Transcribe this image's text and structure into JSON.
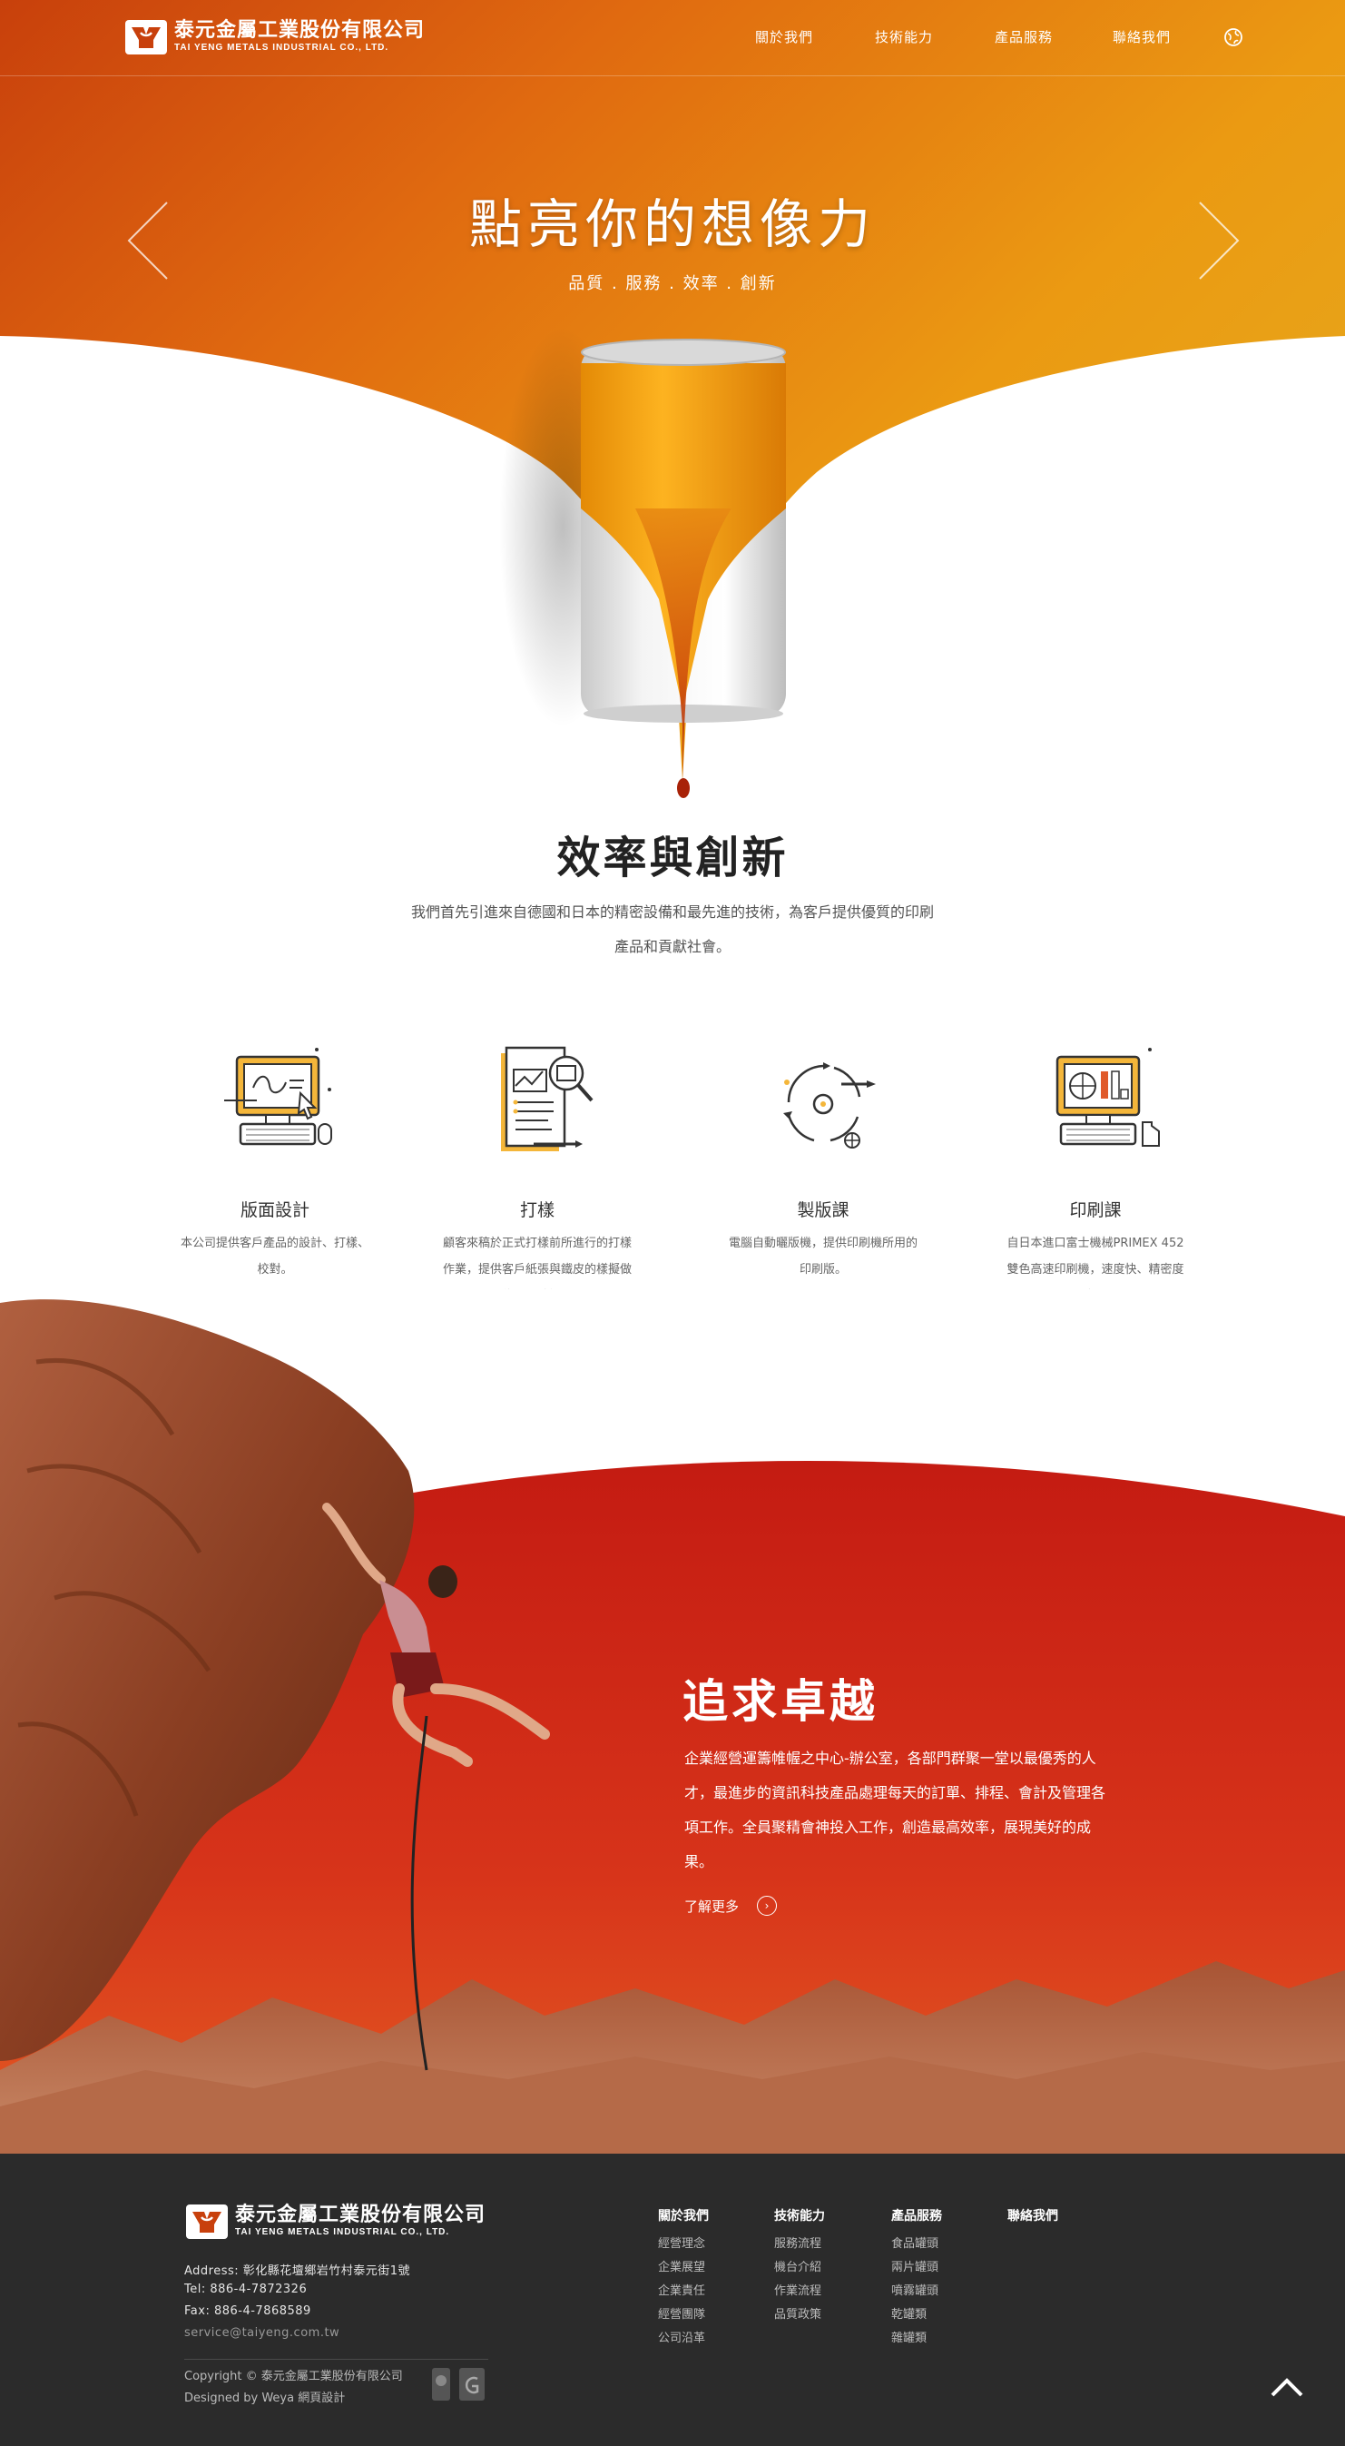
{
  "brand": {
    "name_cn": "泰元金屬工業股份有限公司",
    "name_en": "TAI YENG METALS INDUSTRIAL CO., LTD."
  },
  "nav": {
    "items": [
      {
        "label": "關於我們"
      },
      {
        "label": "技術能力"
      },
      {
        "label": "產品服務"
      },
      {
        "label": "聯絡我們"
      }
    ],
    "globe_icon": "globe-icon"
  },
  "hero": {
    "title": "點亮你的想像力",
    "subtitle": "品質 . 服務 . 效率 . 創新"
  },
  "efficiency": {
    "title": "效率與創新",
    "description": "我們首先引進來自德國和日本的精密設備和最先進的技術，為客戶提供優質的印刷產品和貢獻社會。"
  },
  "services": [
    {
      "title": "版面設計",
      "desc": "本公司提供客戶產品的設計、打樣、校對。",
      "icon": "computer-design-icon"
    },
    {
      "title": "打樣",
      "desc": "顧客來稿於正式打樣前所進行的打樣作業，提供客戶紙張與鐵皮的樣擬做修正及確認。",
      "icon": "proof-document-icon"
    },
    {
      "title": "製版課",
      "desc": "電腦自動曬版機，提供印刷機所用的印刷版。",
      "icon": "plate-cycle-icon"
    },
    {
      "title": "印刷課",
      "desc": "自日本進口富士機械PRIMEX 452 雙色高速印刷機，速度快、精密度高。",
      "icon": "printing-computer-icon"
    }
  ],
  "pursuit": {
    "title": "追求卓越",
    "description": "企業經營運籌帷幄之中心-辦公室，各部門群聚一堂以最優秀的人才，最進步的資訊科技產品處理每天的訂單、排程、會計及管理各項工作。全員聚精會神投入工作，創造最高效率，展現美好的成果。",
    "more_label": "了解更多"
  },
  "footer": {
    "address": "Address: 彰化縣花壇鄉岩竹村泰元街1號",
    "tel": "Tel: 886-4-7872326",
    "fax": "Fax: 886-4-7868589",
    "email": "service@taiyeng.com.tw",
    "copyright": "Copyright © 泰元金屬工業股份有限公司",
    "designed": "Designed by Weya 網頁設計",
    "columns": [
      {
        "title": "關於我們",
        "items": [
          "經營理念",
          "企業展望",
          "企業責任",
          "經營團隊",
          "公司沿革"
        ]
      },
      {
        "title": "技術能力",
        "items": [
          "服務流程",
          "機台介紹",
          "作業流程",
          "品質政策"
        ]
      },
      {
        "title": "產品服務",
        "items": [
          "食品罐頭",
          "兩片罐頭",
          "噴霧罐頭",
          "乾罐類",
          "雜罐類"
        ]
      },
      {
        "title": "聯絡我們",
        "items": []
      }
    ]
  },
  "colors": {
    "orange": "#e8890f",
    "red": "#d42a10",
    "footer_bg": "#2b2b2b"
  }
}
